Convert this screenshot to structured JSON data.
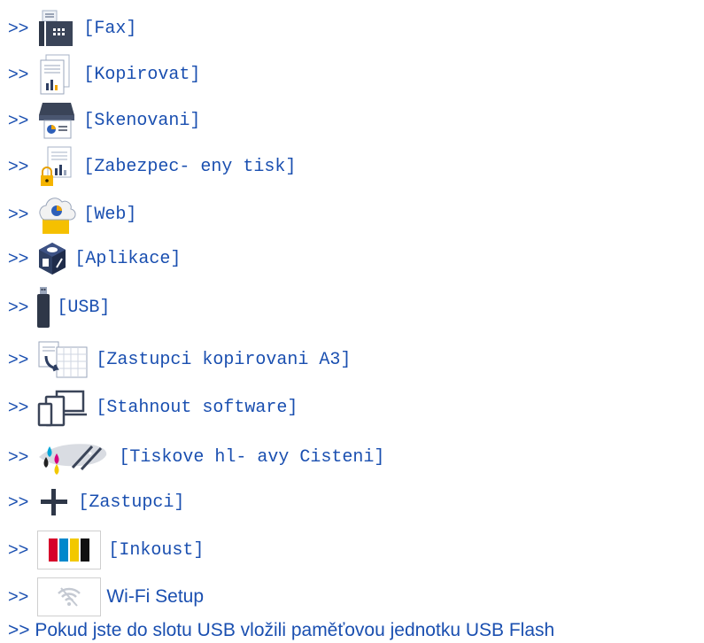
{
  "arrow": ">>",
  "items": [
    {
      "label": "[Fax]",
      "icon": "fax-icon"
    },
    {
      "label": "[Kopirovat]",
      "icon": "copy-icon"
    },
    {
      "label": "[Skenovani]",
      "icon": "scan-icon"
    },
    {
      "label": "[Zabezpec- eny tisk]",
      "icon": "secure-print-icon"
    },
    {
      "label": "[Web]",
      "icon": "web-icon"
    },
    {
      "label": "[Aplikace]",
      "icon": "apps-icon"
    },
    {
      "label": "[USB]",
      "icon": "usb-icon"
    },
    {
      "label": "[Zastupci kopirovani A3]",
      "icon": "a3-copy-shortcut-icon"
    },
    {
      "label": "[Stahnout software]",
      "icon": "download-software-icon"
    },
    {
      "label": "[Tiskove hl- avy Cisteni]",
      "icon": "printhead-cleaning-icon"
    },
    {
      "label": "[Zastupci]",
      "icon": "plus-icon"
    },
    {
      "label": "[Inkoust]",
      "icon": "ink-icon"
    },
    {
      "label": "Wi-Fi Setup",
      "icon": "wifi-icon"
    }
  ],
  "footer_link": ">> Pokud jste do slotu USB vložili paměťovou jednotku USB Flash",
  "colors": {
    "link": "#1a4fb0"
  }
}
